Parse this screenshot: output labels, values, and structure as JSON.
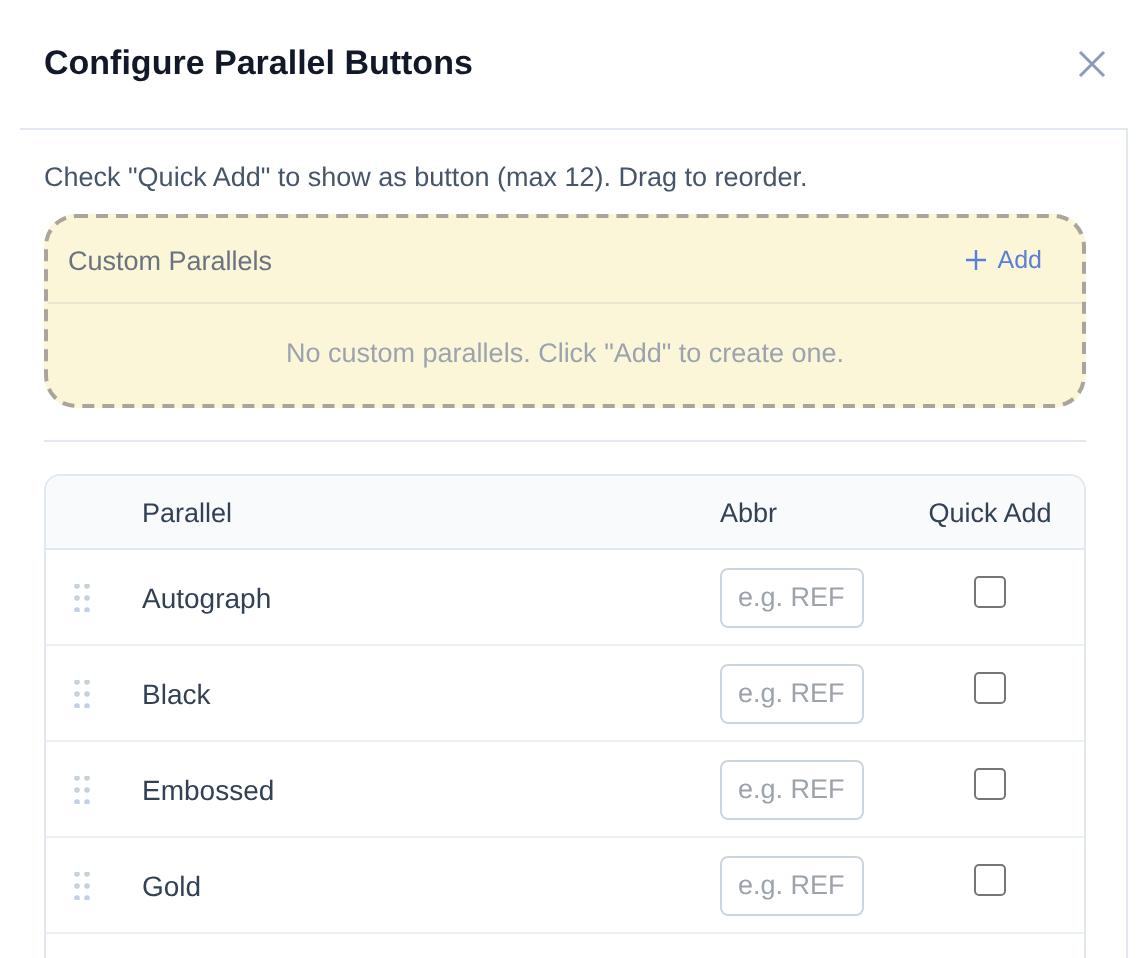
{
  "dialog": {
    "title": "Configure Parallel Buttons"
  },
  "instructions": "Check \"Quick Add\" to show as button (max 12). Drag to reorder.",
  "custom_parallels": {
    "title": "Custom Parallels",
    "add_label": "Add",
    "empty_message": "No custom parallels. Click \"Add\" to create one."
  },
  "table": {
    "columns": [
      "Parallel",
      "Abbr",
      "Quick Add"
    ],
    "rows": [
      {
        "parallel": "Autograph",
        "abbr_placeholder": "e.g. REF",
        "quick_add": false
      },
      {
        "parallel": "Black",
        "abbr_placeholder": "e.g. REF",
        "quick_add": false
      },
      {
        "parallel": "Embossed",
        "abbr_placeholder": "e.g. REF",
        "quick_add": false
      },
      {
        "parallel": "Gold",
        "abbr_placeholder": "e.g. REF",
        "quick_add": false
      }
    ]
  }
}
